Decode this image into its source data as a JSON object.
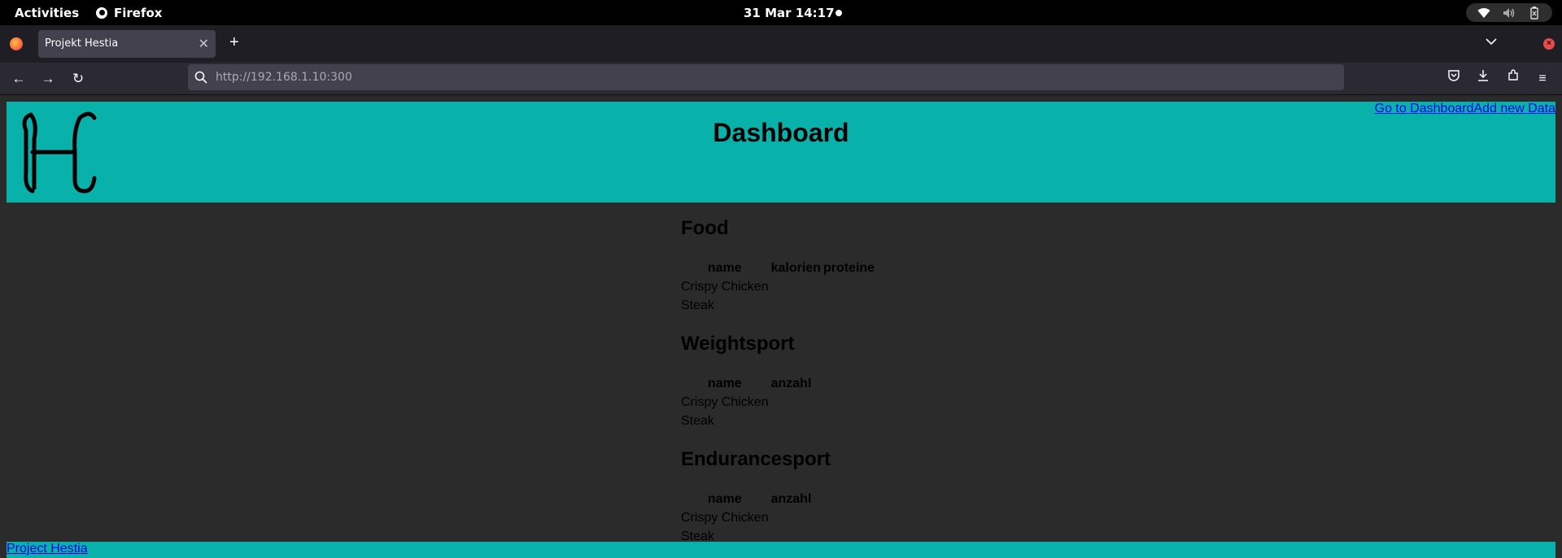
{
  "system_bar": {
    "activities": "Activities",
    "app_name": "Firefox",
    "clock": "31 Mar  14:17"
  },
  "browser": {
    "tab_title": "Projekt Hestia",
    "url_host": "http://192.168.1.10",
    "url_port": ":300"
  },
  "page": {
    "title": "Dashboard",
    "links": {
      "dashboard": "Go to Dashboard",
      "add_data": "Add new Data"
    },
    "sections": [
      {
        "title": "Food",
        "columns": [
          "name",
          "kalorien",
          "proteine"
        ],
        "rows": [
          [
            "Crispy Chicken",
            "",
            ""
          ],
          [
            "Steak",
            "",
            ""
          ]
        ]
      },
      {
        "title": "Weightsport",
        "columns": [
          "name",
          "anzahl"
        ],
        "rows": [
          [
            "Crispy Chicken",
            ""
          ],
          [
            "Steak",
            ""
          ]
        ]
      },
      {
        "title": "Endurancesport",
        "columns": [
          "name",
          "anzahl"
        ],
        "rows": [
          [
            "Crispy Chicken",
            ""
          ],
          [
            "Steak",
            ""
          ]
        ]
      }
    ],
    "footer_link": "Project Hestia"
  },
  "colors": {
    "header_bg": "#08b1aa",
    "page_bg": "#2b2b2b",
    "link": "#0000ee"
  }
}
